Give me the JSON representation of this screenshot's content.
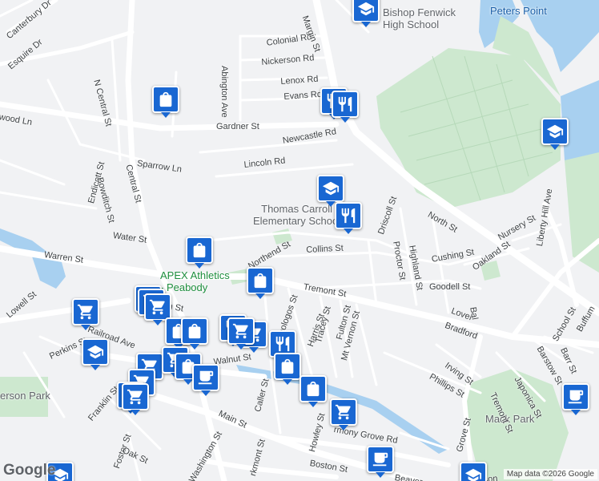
{
  "colors": {
    "road": "#ffffff",
    "park": "#cde8cf",
    "water": "#a8d0f0",
    "pin": "#1967d2",
    "land": "#f1f2f4"
  },
  "places": [
    {
      "id": "peters-point",
      "text": "Peters Point",
      "cls": "blue"
    },
    {
      "id": "bishop-fenwick",
      "text": "Bishop Fenwick\nHigh School",
      "cls": ""
    },
    {
      "id": "thomas-carroll",
      "text": "Thomas Carroll\nElementary School",
      "cls": ""
    },
    {
      "id": "apex",
      "text": "APEX Athletics\n- Peabody",
      "cls": ""
    },
    {
      "id": "mack-park",
      "text": "Mack Park",
      "cls": ""
    },
    {
      "id": "erson-park",
      "text": "erson Park",
      "cls": ""
    }
  ],
  "streets": [
    "Canterbury Dr",
    "Esquire Dr",
    "Colonial Rd",
    "Nickerson Rd",
    "Lenox Rd",
    "Evans Rd",
    "Abington Ave",
    "Margin St",
    "Gardner St",
    "Newcastle Rd",
    "N Central St",
    "wood Ln",
    "Endicott St",
    "Sparrow Ln",
    "Lincoln Rd",
    "Bowditch St",
    "Central St",
    "Water St",
    "Warren St",
    "Northend St",
    "Collins St",
    "Driscoll St",
    "Proctor St",
    "Highland St",
    "North St",
    "Nursery St",
    "Liberty Hill Ave",
    "Cushing St",
    "Oakland St",
    "Tremont St",
    "Goodell St",
    "Lowell St",
    "Elm St",
    "Railroad Ave",
    "Perkins St",
    "Walnut St",
    "Franklin St",
    "Main St",
    "Foster St",
    "Oak St",
    "Washington St",
    "Caller St",
    "Paleologos St",
    "Harris St",
    "Tracey St",
    "Fulton St",
    "Mt Vernon St",
    "Howley St",
    "Grove St",
    "rmony Grove Rd",
    "Boston St",
    "Irving St",
    "Phillips St",
    "Tremont St",
    "Japonica St",
    "Barstow St",
    "Barr St",
    "School St",
    "Buffum",
    "Bradford",
    "Lover",
    "Bal",
    "Mason",
    "Beaver",
    "rkmont St"
  ],
  "pins": [
    {
      "type": "school"
    },
    {
      "type": "shopping"
    },
    {
      "type": "restaurant"
    },
    {
      "type": "restaurant"
    },
    {
      "type": "school"
    },
    {
      "type": "school"
    },
    {
      "type": "restaurant"
    },
    {
      "type": "shopping"
    },
    {
      "type": "shopping"
    },
    {
      "type": "grocery"
    },
    {
      "type": "grocery"
    },
    {
      "type": "grocery"
    },
    {
      "type": "grocery"
    },
    {
      "type": "shopping"
    },
    {
      "type": "shopping"
    },
    {
      "type": "grocery"
    },
    {
      "type": "restaurant"
    },
    {
      "type": "grocery"
    },
    {
      "type": "restaurant"
    },
    {
      "type": "school"
    },
    {
      "type": "grocery"
    },
    {
      "type": "grocery"
    },
    {
      "type": "shopping"
    },
    {
      "type": "cafe"
    },
    {
      "type": "grocery"
    },
    {
      "type": "grocery"
    },
    {
      "type": "shopping"
    },
    {
      "type": "shopping"
    },
    {
      "type": "grocery"
    },
    {
      "type": "grocery"
    },
    {
      "type": "cafe"
    },
    {
      "type": "cafe"
    },
    {
      "type": "school"
    },
    {
      "type": "school"
    }
  ],
  "logo": "Google",
  "credit": "Map data ©2026 Google"
}
